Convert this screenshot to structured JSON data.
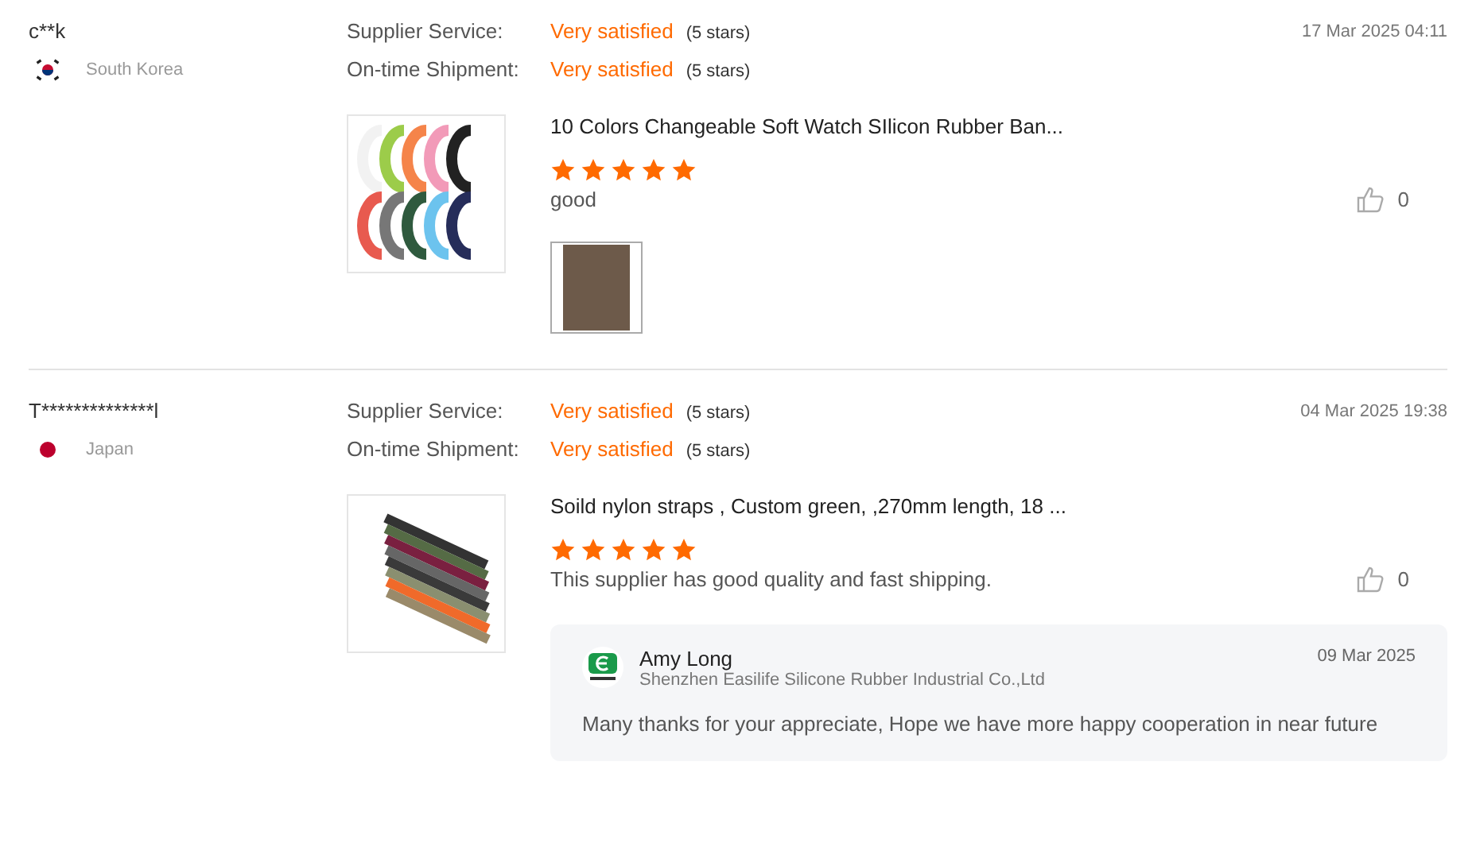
{
  "reviews": [
    {
      "buyer": "c**k",
      "country": "South Korea",
      "flag": {
        "kind": "kr"
      },
      "ratings": [
        {
          "label": "Supplier Service:",
          "value": "Very satisfied",
          "stars_text": "(5 stars)"
        },
        {
          "label": "On-time Shipment:",
          "value": "Very satisfied",
          "stars_text": "(5 stars)"
        }
      ],
      "date": "17 Mar 2025 04:11",
      "product": {
        "kind": "bands",
        "title": "10 Colors Changeable Soft Watch SIlicon Rubber Ban..."
      },
      "stars": 5,
      "comment": "good",
      "likes": "0",
      "attachments": [
        {
          "kind": "photo"
        }
      ]
    },
    {
      "buyer": "T**************l",
      "country": "Japan",
      "flag": {
        "kind": "jp"
      },
      "ratings": [
        {
          "label": "Supplier Service:",
          "value": "Very satisfied",
          "stars_text": "(5 stars)"
        },
        {
          "label": "On-time Shipment:",
          "value": "Very satisfied",
          "stars_text": "(5 stars)"
        }
      ],
      "date": "04 Mar 2025 19:38",
      "product": {
        "kind": "straps",
        "title": "Soild nylon straps , Custom green, ,270mm length, 18 ..."
      },
      "stars": 5,
      "comment": "This supplier has good quality and fast shipping.",
      "likes": "0",
      "reply": {
        "name": "Amy Long",
        "company": "Shenzhen Easilife Silicone Rubber Industrial Co.,Ltd",
        "date": "09 Mar 2025",
        "text": "Many thanks for your appreciate, Hope we have more happy cooperation in near future"
      }
    }
  ]
}
